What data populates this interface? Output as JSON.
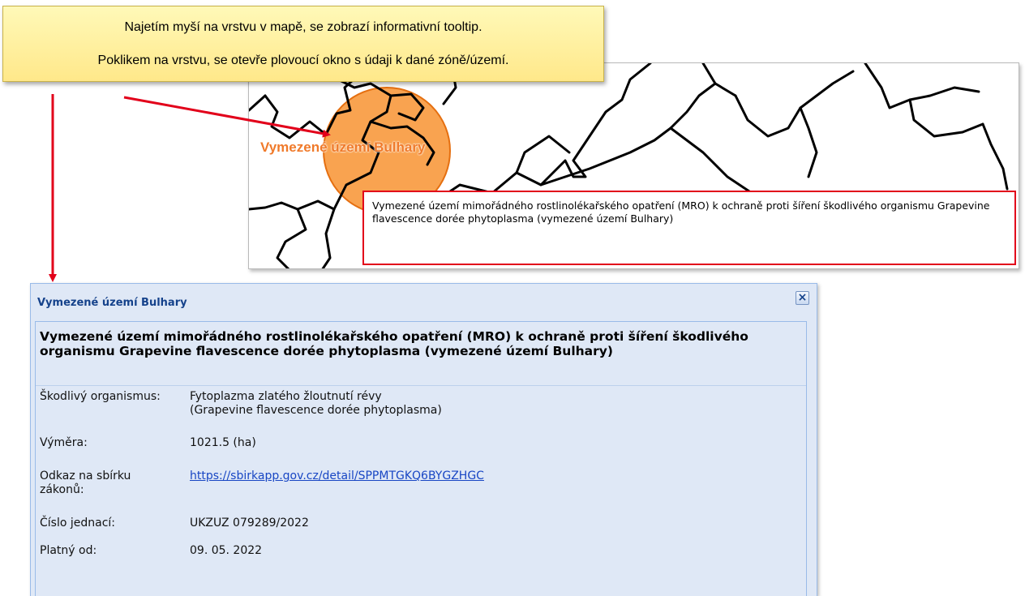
{
  "callout": {
    "line1": "Najetím myší na vrstvu v mapě, se zobrazí informativní tooltip.",
    "line2": "Poklikem na vrstvu, se otevře plovoucí okno s údaji k dané zóně/území."
  },
  "map": {
    "label": "Vymezené území Bulhary",
    "tooltip": "Vymezené území mimořádného rostlinolékařského opatření (MRO) k ochraně proti šíření škodlivého organismu Grapevine flavescence dorée phytoplasma (vymezené území Bulhary)",
    "highlight_color": "#f47a1f",
    "tooltip_border_color": "#e2001a"
  },
  "window": {
    "title": "Vymezené území Bulhary",
    "close_icon": "×",
    "heading": "Vymezené území mimořádného rostlinolékařského opatření (MRO) k ochraně proti šíření škodlivého organismu Grapevine flavescence dorée phytoplasma (vymezené území Bulhary)",
    "fields": [
      {
        "label": "Škodlivý organismus:",
        "value": "Fytoplazma zlatého žloutnutí révy",
        "value2": "(Grapevine flavescence dorée phytoplasma)"
      },
      {
        "label": "Výměra:",
        "value": "1021.5 (ha)"
      },
      {
        "label": "Odkaz na sbírku",
        "label2": "zákonů:",
        "value": "https://sbirkapp.gov.cz/detail/SPPMTGKQ6BYGZHGC"
      },
      {
        "label": "Číslo jednací:",
        "value": "UKZUZ 079289/2022"
      },
      {
        "label": "Platný od:",
        "value": "09. 05. 2022"
      }
    ]
  },
  "colors": {
    "arrow": "#e2001a",
    "window_title": "#15428b",
    "link": "#1846c4"
  }
}
